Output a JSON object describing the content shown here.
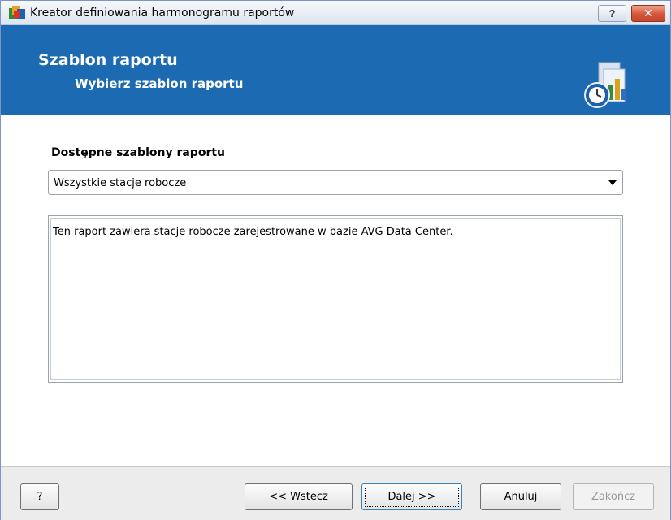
{
  "window": {
    "title": "Kreator definiowania harmonogramu raportów",
    "help_label": "?",
    "close_label": "✕"
  },
  "header": {
    "title": "Szablon raportu",
    "subtitle": "Wybierz szablon raportu"
  },
  "content": {
    "templates_label": "Dostępne szablony raportu",
    "selected_template": "Wszystkie stacje robocze",
    "description": "Ten raport zawiera stacje robocze zarejestrowane w bazie AVG Data Center."
  },
  "footer": {
    "help_label": "?",
    "back_label": "<< Wstecz",
    "next_label": "Dalej >>",
    "cancel_label": "Anuluj",
    "finish_label": "Zakończ"
  },
  "colors": {
    "banner": "#1c6bb2",
    "close_button": "#c6452c"
  }
}
